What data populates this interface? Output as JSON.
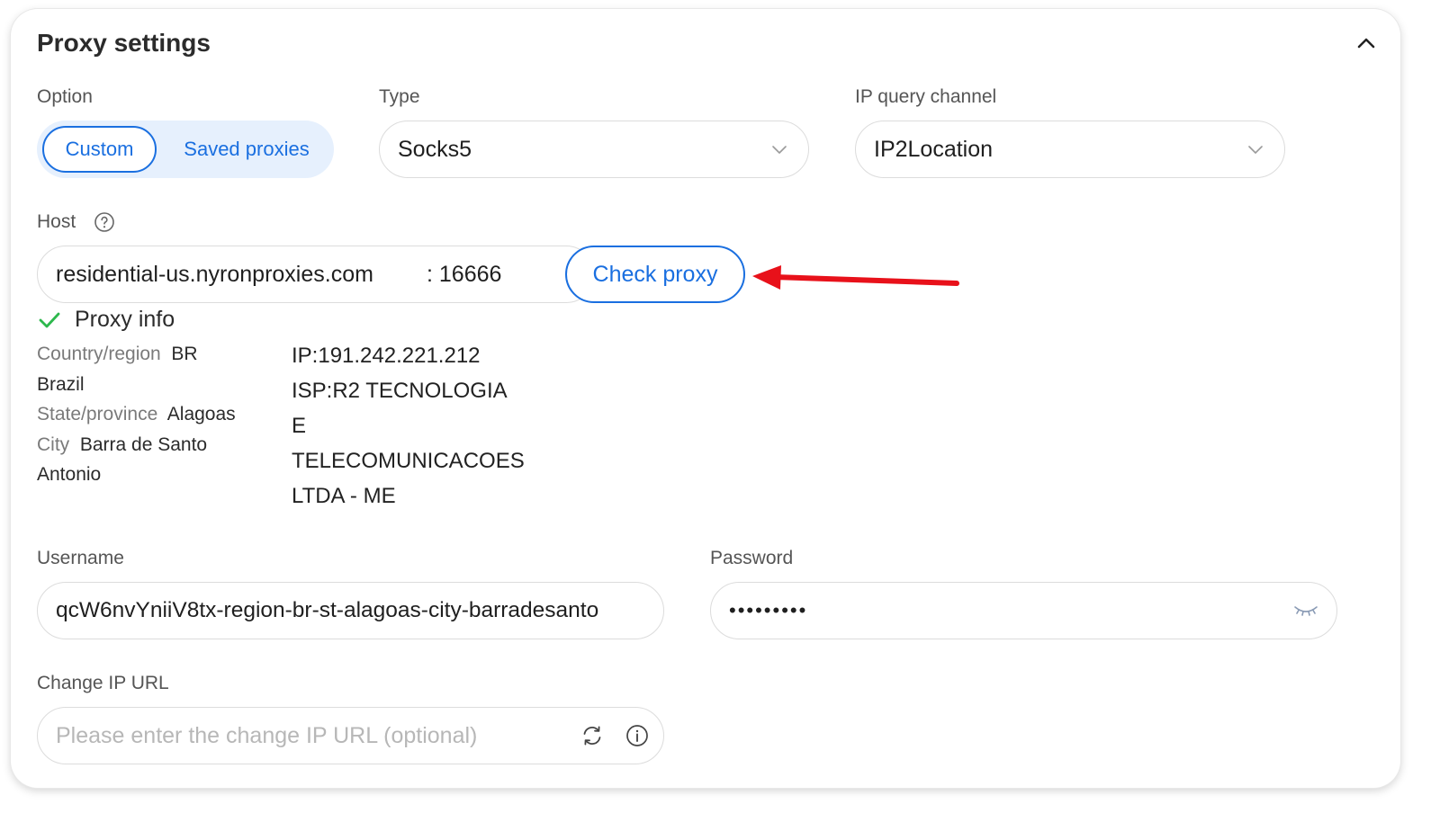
{
  "panel": {
    "title": "Proxy settings"
  },
  "option": {
    "label": "Option",
    "segments": [
      "Custom",
      "Saved proxies"
    ]
  },
  "type": {
    "label": "Type",
    "value": "Socks5"
  },
  "channel": {
    "label": "IP query channel",
    "value": "IP2Location"
  },
  "host": {
    "label": "Host",
    "value": "residential-us.nyronproxies.com",
    "port": ": 16666",
    "check_label": "Check proxy"
  },
  "proxy_info": {
    "title": "Proxy info",
    "country_key": "Country/region",
    "country_code": "BR",
    "country_name": "Brazil",
    "state_key": "State/province",
    "state_value": "Alagoas",
    "city_key": "City",
    "city_value_1": "Barra de Santo",
    "city_value_2": "Antonio",
    "ip": "IP:191.242.221.212",
    "isp_lines": [
      "ISP:R2 TECNOLOGIA",
      "E",
      "TELECOMUNICACOES",
      "LTDA - ME"
    ]
  },
  "username": {
    "label": "Username",
    "value": "qcW6nvYniiV8tx-region-br-st-alagoas-city-barradesanto"
  },
  "password": {
    "label": "Password",
    "value": "•••••••••"
  },
  "change_ip": {
    "label": "Change IP URL",
    "placeholder": "Please enter the change IP URL (optional)"
  },
  "colors": {
    "accent": "#1a6fe0",
    "success": "#2db84d",
    "arrow": "#e8111a"
  },
  "icons": [
    "chevron-up-icon",
    "chevron-down-icon",
    "help-icon",
    "check-icon",
    "eye-closed-icon",
    "refresh-icon",
    "info-icon",
    "arrow-icon"
  ]
}
